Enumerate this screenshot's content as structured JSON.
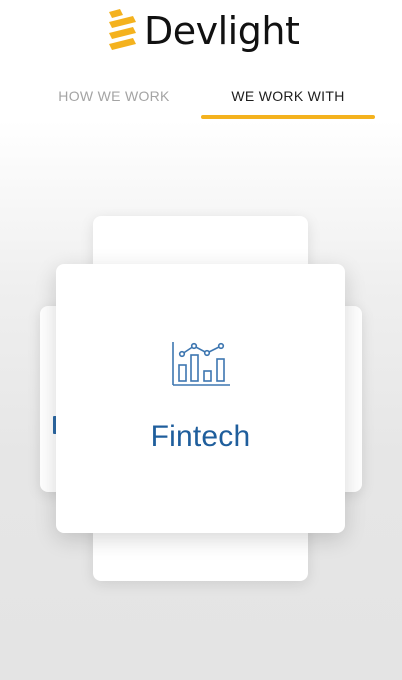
{
  "header": {
    "brand_name": "Devlight",
    "logo_icon": "devlight-stripes-logo-icon",
    "brand_color": "#f4b21e"
  },
  "tabs": [
    {
      "label": "HOW WE WORK",
      "active": false
    },
    {
      "label": "WE WORK WITH",
      "active": true
    }
  ],
  "carousel": {
    "active_card": {
      "label": "Fintech",
      "icon": "bar-chart-trend-icon",
      "accent_color": "#1f5e9c"
    }
  }
}
